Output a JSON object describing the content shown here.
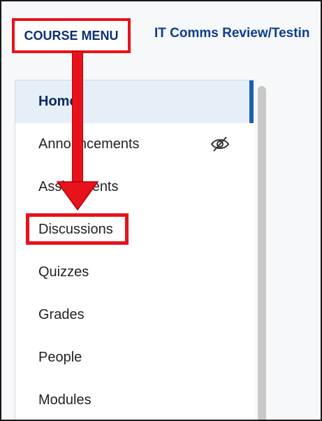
{
  "header": {
    "course_menu_label": "COURSE MENU",
    "course_title": "IT Comms Review/Testin"
  },
  "menu": {
    "items": [
      {
        "label": "Home",
        "active": true
      },
      {
        "label": "Announcements",
        "hidden": true,
        "icon": "eye-slash-icon"
      },
      {
        "label": "Assignments"
      },
      {
        "label": "Discussions",
        "highlighted": true
      },
      {
        "label": "Quizzes"
      },
      {
        "label": "Grades"
      },
      {
        "label": "People"
      },
      {
        "label": "Modules"
      }
    ]
  },
  "colors": {
    "annotation": "#e8121b",
    "accent": "#1a5fb4",
    "title": "#0b3d91"
  }
}
